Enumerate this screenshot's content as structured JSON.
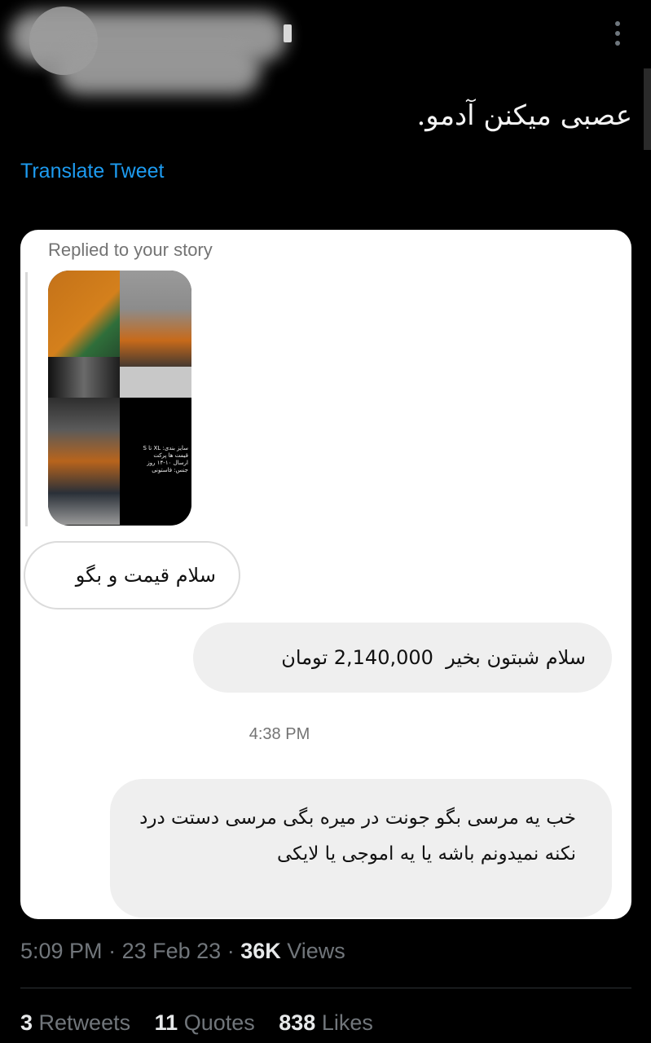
{
  "tweet": {
    "text": "عصبی میکنن آدمو.",
    "translate_label": "Translate Tweet"
  },
  "screenshot": {
    "replied_label": "Replied to your story",
    "story_caption": "سایز بندی: XL تا S\nقیمت ها پرکت\nارسال ۱۰-۱۴ روز\nجنس: فاستونی",
    "messages": [
      {
        "id": "incoming-1",
        "text": "سلام قیمت و بگو"
      },
      {
        "id": "outgoing-1",
        "text": "سلام شبتون بخیر  2,140,000 تومان"
      },
      {
        "id": "outgoing-2",
        "text": "خب یه مرسی بگو جونت در میره بگی مرسی دستت درد نکنه نمیدونم باشه یا یه اموجی یا لایکی"
      }
    ],
    "timestamp": "4:38 PM"
  },
  "meta": {
    "time": "5:09 PM",
    "date": "23 Feb 23",
    "views_count": "36K",
    "views_label": "Views"
  },
  "stats": {
    "retweets_count": "3",
    "retweets_label": "Retweets",
    "quotes_count": "11",
    "quotes_label": "Quotes",
    "likes_count": "838",
    "likes_label": "Likes"
  },
  "colors": {
    "background": "#000000",
    "link": "#1d9bf0",
    "muted": "#71767b"
  },
  "icons": [
    "more-options-icon"
  ]
}
